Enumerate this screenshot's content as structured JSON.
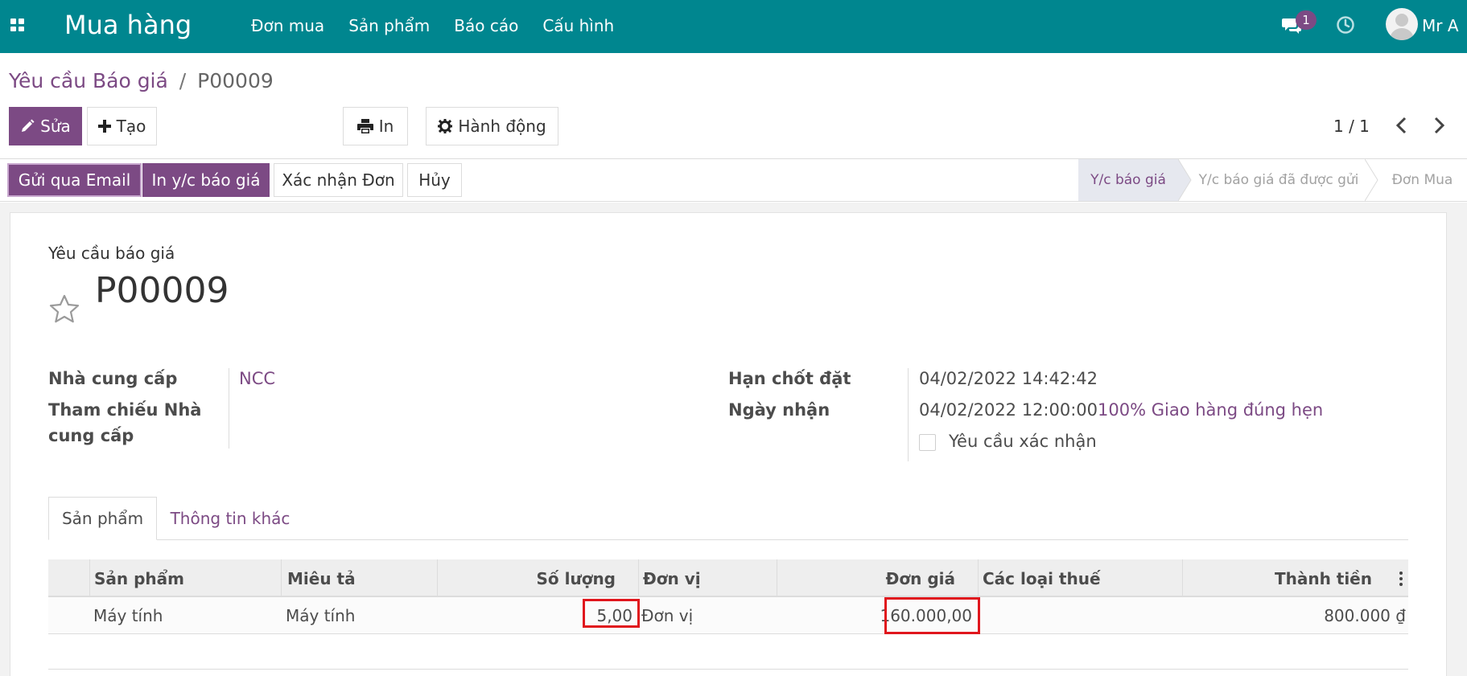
{
  "navbar": {
    "app_title": "Mua hàng",
    "menu": [
      "Đơn mua",
      "Sản phẩm",
      "Báo cáo",
      "Cấu hình"
    ],
    "chat_count": "1",
    "user_name": "Mr A",
    "background_color": "#00868f"
  },
  "breadcrumb": {
    "parent": "Yêu cầu Báo giá",
    "separator": "/",
    "current": "P00009"
  },
  "toolbar": {
    "edit_label": "Sửa",
    "create_label": "Tạo",
    "print_label": "In",
    "action_label": "Hành động"
  },
  "pager": {
    "value": "1 / 1"
  },
  "statusbar": {
    "buttons": [
      "Gửi qua Email",
      "In y/c báo giá",
      "Xác nhận Đơn",
      "Hủy"
    ],
    "stages": [
      "Y/c báo giá",
      "Y/c báo giá đã được gửi",
      "Đơn Mua"
    ],
    "active_stage": "Y/c báo giá"
  },
  "form": {
    "title_label": "Yêu cầu báo giá",
    "record_name": "P00009",
    "vendor_label": "Nhà cung cấp",
    "vendor_value": "NCC",
    "vendor_ref_label_1": "Tham chiếu Nhà",
    "vendor_ref_label_2": "cung cấp",
    "deadline_label": "Hạn chốt đặt",
    "deadline_value": "04/02/2022 14:42:42",
    "receipt_label": "Ngày nhận",
    "receipt_value": "04/02/2022 12:00:00",
    "on_time_text": "100% Giao hàng đúng hẹn",
    "ask_confirm_label": "Yêu cầu xác nhận",
    "ask_confirm_checked": false
  },
  "tabs": [
    "Sản phẩm",
    "Thông tin khác"
  ],
  "order_lines": {
    "columns": [
      "Sản phẩm",
      "Miêu tả",
      "Số lượng",
      "Đơn vị",
      "Đơn giá",
      "Các loại thuế",
      "Thành tiền"
    ],
    "rows": [
      {
        "product": "Máy tính",
        "description": "Máy tính",
        "quantity": "5,00",
        "uom": "Đơn vị",
        "unit_price": "160.000,00",
        "taxes": "",
        "subtotal": "800.000 ₫"
      }
    ]
  },
  "colors": {
    "brand_purple": "#7c4a84",
    "highlight_red": "#e0161d"
  }
}
